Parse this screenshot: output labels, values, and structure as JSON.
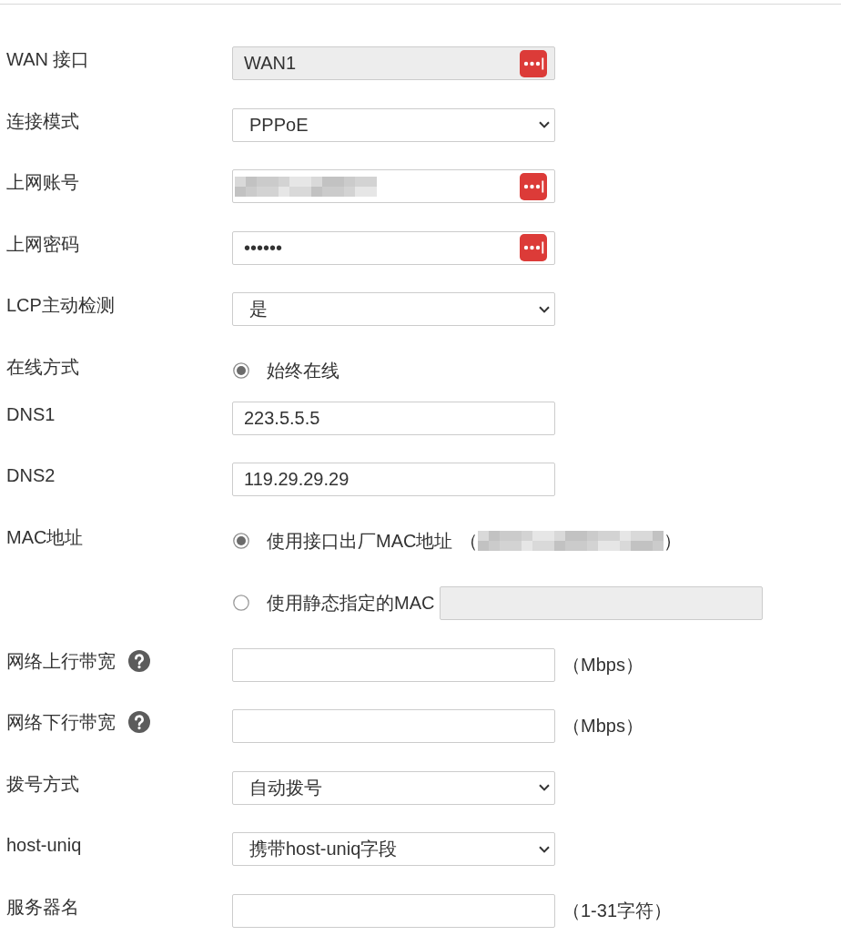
{
  "form": {
    "rows": [
      {
        "kind": "text",
        "label": "WAN 接口",
        "field": {
          "value": "WAN1",
          "disabled": true,
          "autofill_icon": true
        }
      },
      {
        "kind": "select",
        "label": "连接模式",
        "field": {
          "value": "PPPoE"
        }
      },
      {
        "kind": "text",
        "label": "上网账号",
        "field": {
          "disabled": false,
          "redacted": true,
          "autofill_icon": true
        }
      },
      {
        "kind": "text",
        "label": "上网密码",
        "field": {
          "value": "••••••",
          "disabled": false,
          "autofill_icon": true
        }
      },
      {
        "kind": "select",
        "label": "LCP主动检测",
        "field": {
          "value": "是"
        }
      },
      {
        "kind": "radio",
        "label": "在线方式",
        "options": [
          {
            "label": "始终在线",
            "selected": true
          }
        ]
      },
      {
        "kind": "text",
        "label": "DNS1",
        "field": {
          "value": "223.5.5.5",
          "disabled": false
        }
      },
      {
        "kind": "text",
        "label": "DNS2",
        "field": {
          "value": "119.29.29.29",
          "disabled": false
        }
      },
      {
        "kind": "radio",
        "label": "MAC地址",
        "options": [
          {
            "label": "使用接口出厂MAC地址",
            "selected": true,
            "detail": {
              "open": "（",
              "redacted": true,
              "close": "）"
            }
          },
          {
            "label": "使用静态指定的MAC",
            "selected": false,
            "field": {
              "disabled": true
            }
          }
        ]
      },
      {
        "kind": "text",
        "label": "网络上行带宽",
        "help": true,
        "field": {
          "disabled": false
        },
        "unit": "（Mbps）"
      },
      {
        "kind": "text",
        "label": "网络下行带宽",
        "help": true,
        "field": {
          "disabled": false
        },
        "unit": "（Mbps）"
      },
      {
        "kind": "select",
        "label": "拨号方式",
        "field": {
          "value": "自动拨号"
        }
      },
      {
        "kind": "select",
        "label": "host-uniq",
        "field": {
          "value": "携带host-uniq字段"
        }
      },
      {
        "kind": "text",
        "label": "服务器名",
        "field": {
          "disabled": false
        },
        "unit": "（1-31字符）"
      }
    ]
  }
}
